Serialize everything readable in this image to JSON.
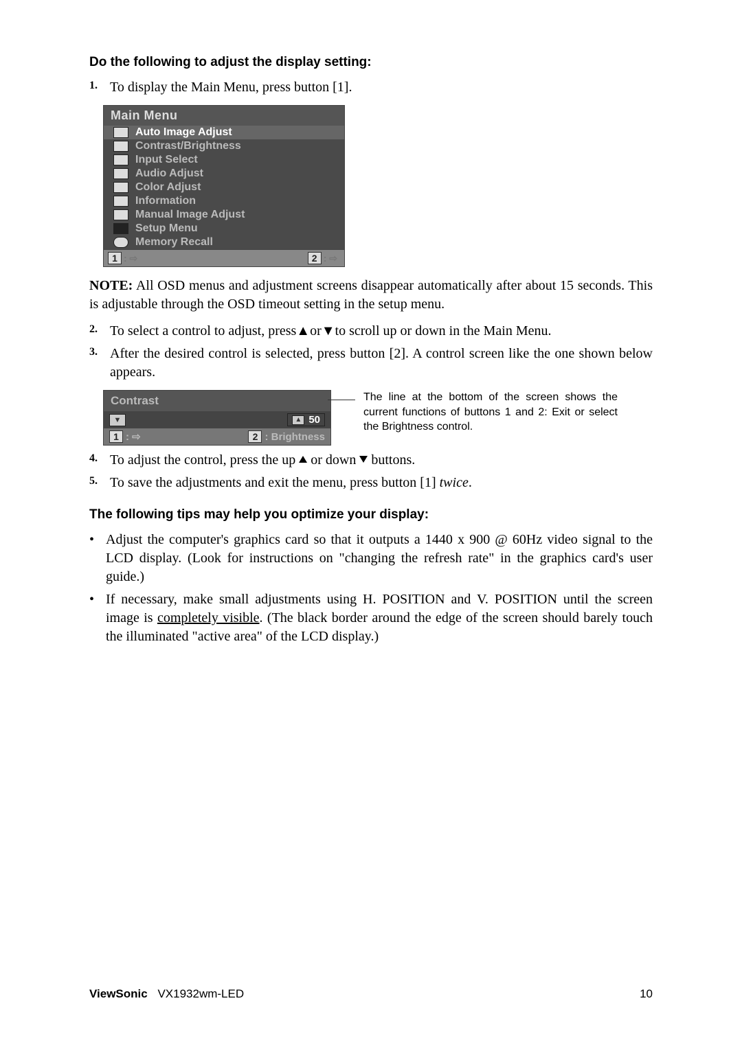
{
  "headings": {
    "adjust": "Do the following to adjust the display setting:",
    "tips": "The following tips may help you optimize your display:"
  },
  "steps": {
    "s1": "To display the Main Menu, press button [1].",
    "s2": "To select a control to adjust, press▲or▼to scroll up or down in the Main Menu.",
    "s3": "After the desired control is selected, press button [2]. A control screen like the one shown below appears.",
    "s4_pre": "To adjust the control, press the up ",
    "s4_mid": " or down ",
    "s4_post": " buttons.",
    "s5_pre": "To save the adjustments and exit the menu, press button [1] ",
    "s5_twice": "twice",
    "s5_post": "."
  },
  "note": {
    "label": "NOTE:",
    "text": " All OSD menus and adjustment screens disappear automatically after about 15 seconds. This is adjustable through the OSD timeout setting in the setup menu."
  },
  "osd": {
    "title": "Main Menu",
    "items": [
      {
        "label": "Auto Image Adjust",
        "selected": true
      },
      {
        "label": "Contrast/Brightness",
        "selected": false
      },
      {
        "label": "Input Select",
        "selected": false
      },
      {
        "label": "Audio Adjust",
        "selected": false
      },
      {
        "label": "Color Adjust",
        "selected": false
      },
      {
        "label": "Information",
        "selected": false
      },
      {
        "label": "Manual Image Adjust",
        "selected": false
      },
      {
        "label": "Setup Menu",
        "selected": false
      },
      {
        "label": "Memory Recall",
        "selected": false
      }
    ],
    "footer_left_key": "1",
    "footer_right_key": "2"
  },
  "contrast": {
    "title": "Contrast",
    "value": "50",
    "footer_left_key": "1",
    "footer_right_key": "2",
    "footer_right_label": ": Brightness"
  },
  "callout": "The line at the bottom of the screen shows the current functions of buttons 1 and 2: Exit or select the Brightness control.",
  "tips": {
    "t1": "Adjust the computer's graphics card so that it outputs a 1440 x 900 @ 60Hz video signal to the LCD display. (Look for instructions on \"changing the refresh rate\" in the graphics card's user guide.)",
    "t2_pre": "If necessary, make small adjustments using H. POSITION and V. POSITION until the screen image is ",
    "t2_ul": "completely visible",
    "t2_post": ". (The black border around the edge of the screen should barely touch the illuminated \"active area\" of the LCD display.)"
  },
  "footer": {
    "brand": "ViewSonic",
    "model": "VX1932wm-LED",
    "page": "10"
  }
}
